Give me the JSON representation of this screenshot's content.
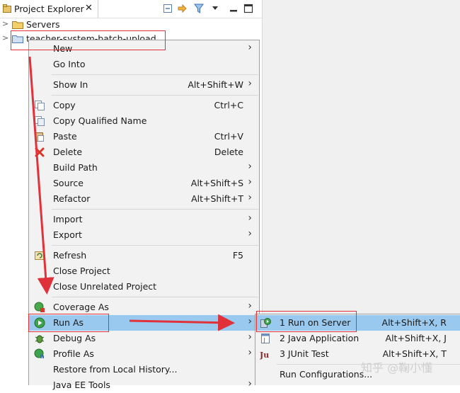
{
  "explorer": {
    "tab_title": "Project Explorer",
    "tab_close": "✕",
    "tree": [
      {
        "label": "Servers",
        "twisty": ">"
      },
      {
        "label": "teacher-system-batch-upload",
        "twisty": ">"
      }
    ]
  },
  "context_menu": {
    "items": [
      {
        "label": "New",
        "shortcut": "",
        "submenu": true
      },
      {
        "label": "Go Into",
        "shortcut": "",
        "submenu": false
      },
      {
        "label": "Show In",
        "shortcut": "Alt+Shift+W",
        "submenu": true
      },
      {
        "label": "Copy",
        "shortcut": "Ctrl+C",
        "submenu": false,
        "icon": "copy-icon"
      },
      {
        "label": "Copy Qualified Name",
        "shortcut": "",
        "submenu": false,
        "icon": "copy-qualified-icon"
      },
      {
        "label": "Paste",
        "shortcut": "Ctrl+V",
        "submenu": false,
        "icon": "paste-icon"
      },
      {
        "label": "Delete",
        "shortcut": "Delete",
        "submenu": false,
        "icon": "delete-icon"
      },
      {
        "label": "Build Path",
        "shortcut": "",
        "submenu": true
      },
      {
        "label": "Source",
        "shortcut": "Alt+Shift+S",
        "submenu": true
      },
      {
        "label": "Refactor",
        "shortcut": "Alt+Shift+T",
        "submenu": true
      },
      {
        "label": "Import",
        "shortcut": "",
        "submenu": true
      },
      {
        "label": "Export",
        "shortcut": "",
        "submenu": true
      },
      {
        "label": "Refresh",
        "shortcut": "F5",
        "submenu": false,
        "icon": "refresh-icon"
      },
      {
        "label": "Close Project",
        "shortcut": "",
        "submenu": false
      },
      {
        "label": "Close Unrelated Project",
        "shortcut": "",
        "submenu": false
      },
      {
        "label": "Coverage As",
        "shortcut": "",
        "submenu": true,
        "icon": "coverage-icon"
      },
      {
        "label": "Run As",
        "shortcut": "",
        "submenu": true,
        "icon": "run-icon",
        "selected": true
      },
      {
        "label": "Debug As",
        "shortcut": "",
        "submenu": true,
        "icon": "debug-icon"
      },
      {
        "label": "Profile As",
        "shortcut": "",
        "submenu": true,
        "icon": "profile-icon"
      },
      {
        "label": "Restore from Local History...",
        "shortcut": "",
        "submenu": false
      },
      {
        "label": "Java EE Tools",
        "shortcut": "",
        "submenu": true
      }
    ]
  },
  "run_as_submenu": {
    "items": [
      {
        "label": "1 Run on Server",
        "shortcut": "Alt+Shift+X, R",
        "icon": "server-run-icon",
        "selected": true
      },
      {
        "label": "2 Java Application",
        "shortcut": "Alt+Shift+X, J",
        "icon": "java-app-icon"
      },
      {
        "label": "3 JUnit Test",
        "shortcut": "Alt+Shift+X, T",
        "icon": "junit-icon"
      },
      {
        "label": "Run Configurations...",
        "shortcut": ""
      }
    ]
  },
  "watermark": "知乎 @鞠小懂",
  "colors": {
    "selection": "#99c9ef",
    "annotation": "#e0323a",
    "menu_bg": "#f2f2f2"
  }
}
